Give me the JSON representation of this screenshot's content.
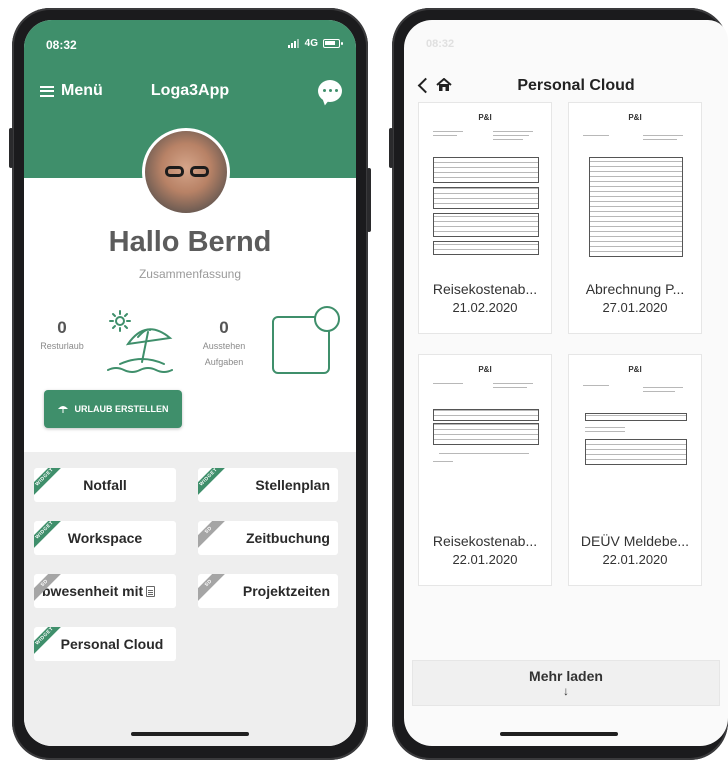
{
  "left_app": {
    "status": {
      "time": "08:32",
      "network": "4G"
    },
    "header": {
      "menu_label": "Menü",
      "title": "Loga3App"
    },
    "greeting": "Hallo Bernd",
    "summary_label": "Zusammenfassung",
    "stats": [
      {
        "value": "0",
        "label": "Resturlaub"
      },
      {
        "value": "0",
        "label_line1": "Ausstehen",
        "label_line2": "Aufgaben"
      }
    ],
    "vacation_button": "URLAUB ERSTELLEN",
    "widgets": [
      {
        "label": "Notfall",
        "ribbon": "WIDGET",
        "ribbon_color": "#3f8f6b"
      },
      {
        "label": "Stellenplan",
        "ribbon": "WIDGET",
        "ribbon_color": "#3f8f6b"
      },
      {
        "label": "Workspace",
        "ribbon": "WIDGET",
        "ribbon_color": "#3f8f6b"
      },
      {
        "label": "Zeitbuchung",
        "ribbon": "SD",
        "ribbon_color": "#a5a5a5"
      },
      {
        "label": "bwesenheit mit",
        "ribbon": "SD",
        "ribbon_color": "#a5a5a5"
      },
      {
        "label": "Projektzeiten",
        "ribbon": "SD",
        "ribbon_color": "#a5a5a5"
      },
      {
        "label": "Personal Cloud",
        "ribbon": "WIDGET",
        "ribbon_color": "#3f8f6b"
      }
    ]
  },
  "right_app": {
    "status": {
      "time": "08:32"
    },
    "nav_title": "Personal Cloud",
    "documents": [
      {
        "name": "Reisekostenab...",
        "date": "21.02.2020"
      },
      {
        "name": "Abrechnung P...",
        "date": "27.01.2020"
      },
      {
        "name": "Reisekostenab...",
        "date": "22.01.2020"
      },
      {
        "name": "DEÜV Meldebe...",
        "date": "22.01.2020"
      }
    ],
    "load_more_label": "Mehr laden",
    "load_more_arrow": "↓"
  },
  "colors": {
    "brand_green": "#3f8f6b",
    "widget_area_bg": "#eeeeee"
  },
  "icons": [
    "hamburger-icon",
    "chat-icon",
    "beach-umbrella-icon",
    "task-icon",
    "umbrella-icon",
    "document-icon",
    "back-icon",
    "home-icon",
    "arrow-down-icon"
  ]
}
